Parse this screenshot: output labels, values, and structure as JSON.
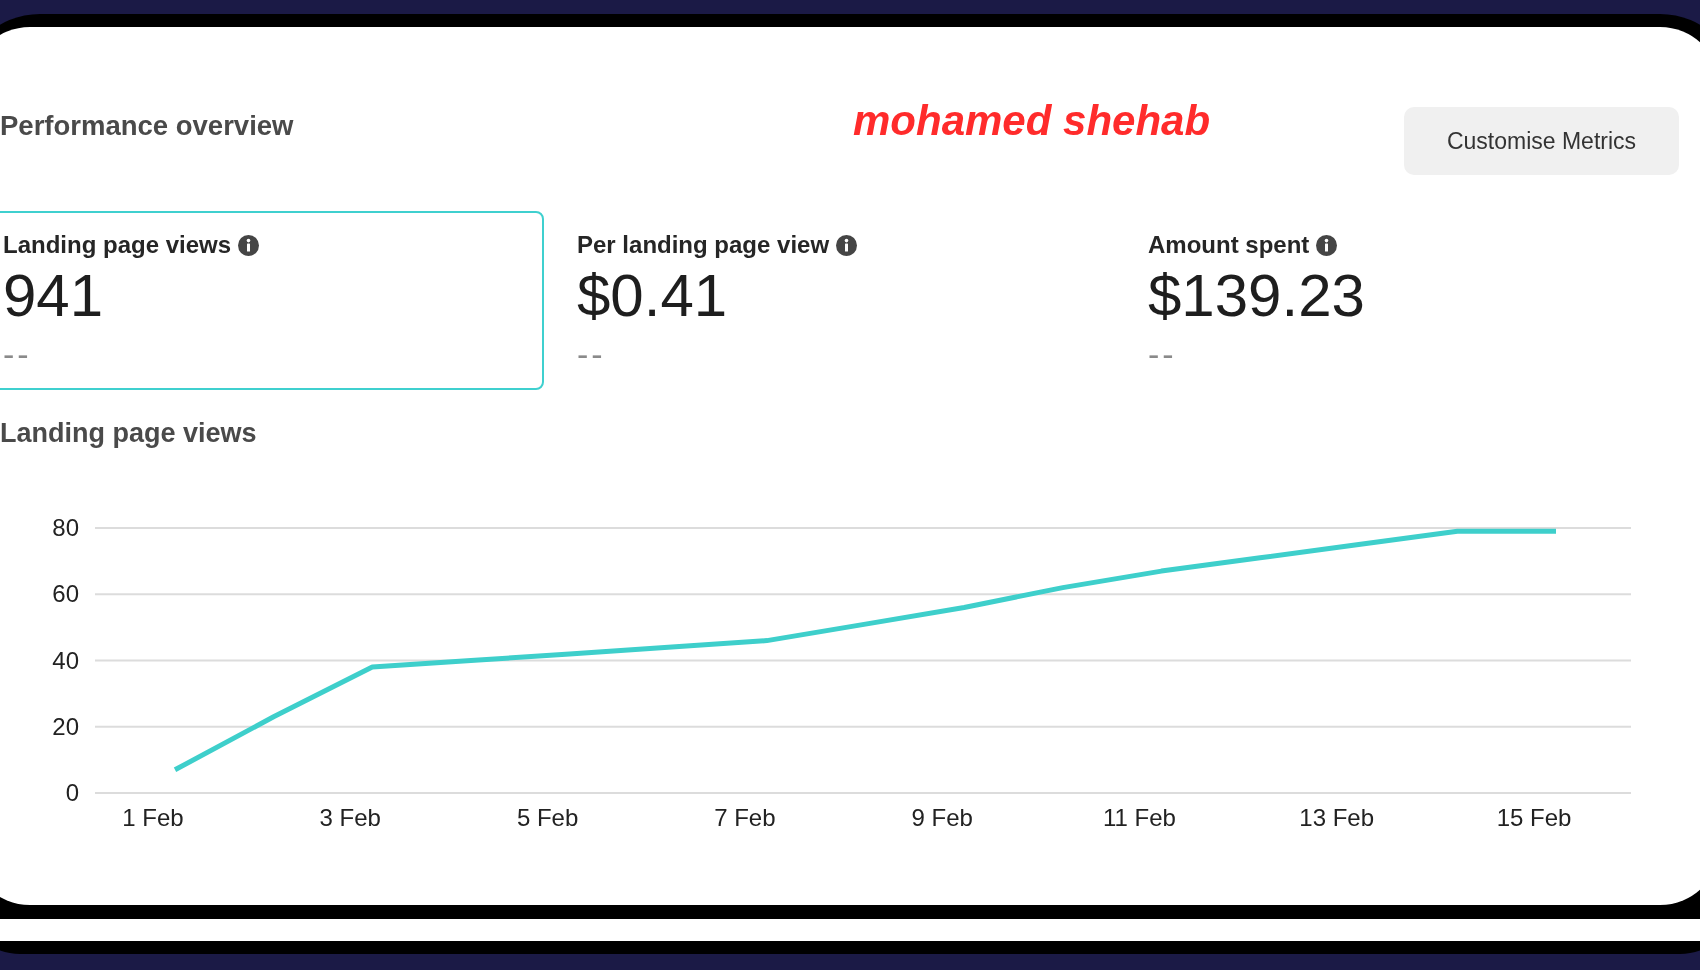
{
  "header": {
    "title": "Performance overview",
    "signature": "mohamed shehab",
    "customise_button": {
      "label": "Customise Metrics"
    }
  },
  "metrics": [
    {
      "label": "Landing page views",
      "value": "941",
      "comparison": "--",
      "selected": true
    },
    {
      "label": "Per landing page view",
      "value": "$0.41",
      "comparison": "--",
      "selected": false
    },
    {
      "label": "Amount spent",
      "value": "$139.23",
      "comparison": "--",
      "selected": false
    }
  ],
  "chart": {
    "chart_data": {
      "type": "line",
      "title": "Landing page views",
      "categories": [
        "1 Feb",
        null,
        "3 Feb",
        null,
        "5 Feb",
        null,
        "7 Feb",
        null,
        "9 Feb",
        null,
        "11 Feb",
        null,
        "13 Feb",
        null,
        "15 Feb"
      ],
      "values": [
        7,
        23,
        38,
        40,
        42,
        44,
        46,
        51,
        56,
        62,
        67,
        71,
        75,
        79,
        79
      ],
      "ylim": [
        0,
        80
      ],
      "yticks": [
        0,
        20,
        40,
        60,
        80
      ],
      "grid": true
    }
  }
}
